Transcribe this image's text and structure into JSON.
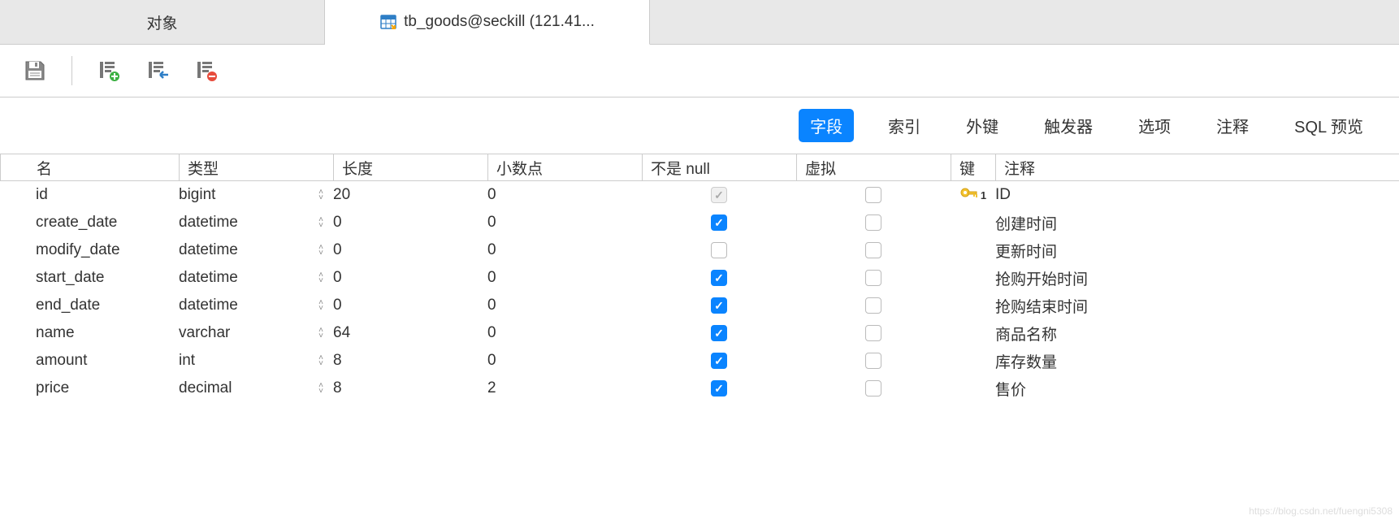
{
  "tabs": [
    {
      "label": "对象",
      "active": false
    },
    {
      "label": "tb_goods@seckill (121.41...",
      "active": true
    }
  ],
  "subtabs": [
    {
      "label": "字段",
      "active": true
    },
    {
      "label": "索引",
      "active": false
    },
    {
      "label": "外键",
      "active": false
    },
    {
      "label": "触发器",
      "active": false
    },
    {
      "label": "选项",
      "active": false
    },
    {
      "label": "注释",
      "active": false
    },
    {
      "label": "SQL 预览",
      "active": false
    }
  ],
  "columns": {
    "name": "名",
    "type": "类型",
    "length": "长度",
    "decimal": "小数点",
    "notnull": "不是 null",
    "virtual": "虚拟",
    "key": "键",
    "comment": "注释"
  },
  "rows": [
    {
      "name": "id",
      "type": "bigint",
      "length": "20",
      "decimal": "0",
      "notnull": true,
      "notnull_disabled": true,
      "virtual": false,
      "key": true,
      "key_index": "1",
      "comment": "ID"
    },
    {
      "name": "create_date",
      "type": "datetime",
      "length": "0",
      "decimal": "0",
      "notnull": true,
      "notnull_disabled": false,
      "virtual": false,
      "key": false,
      "comment": "创建时间"
    },
    {
      "name": "modify_date",
      "type": "datetime",
      "length": "0",
      "decimal": "0",
      "notnull": false,
      "notnull_disabled": false,
      "virtual": false,
      "key": false,
      "comment": "更新时间"
    },
    {
      "name": "start_date",
      "type": "datetime",
      "length": "0",
      "decimal": "0",
      "notnull": true,
      "notnull_disabled": false,
      "virtual": false,
      "key": false,
      "comment": "抢购开始时间"
    },
    {
      "name": "end_date",
      "type": "datetime",
      "length": "0",
      "decimal": "0",
      "notnull": true,
      "notnull_disabled": false,
      "virtual": false,
      "key": false,
      "comment": "抢购结束时间"
    },
    {
      "name": "name",
      "type": "varchar",
      "length": "64",
      "decimal": "0",
      "notnull": true,
      "notnull_disabled": false,
      "virtual": false,
      "key": false,
      "comment": "商品名称"
    },
    {
      "name": "amount",
      "type": "int",
      "length": "8",
      "decimal": "0",
      "notnull": true,
      "notnull_disabled": false,
      "virtual": false,
      "key": false,
      "comment": "库存数量"
    },
    {
      "name": "price",
      "type": "decimal",
      "length": "8",
      "decimal": "2",
      "notnull": true,
      "notnull_disabled": false,
      "virtual": false,
      "key": false,
      "comment": "售价"
    }
  ],
  "watermark": "https://blog.csdn.net/fuengni5308"
}
